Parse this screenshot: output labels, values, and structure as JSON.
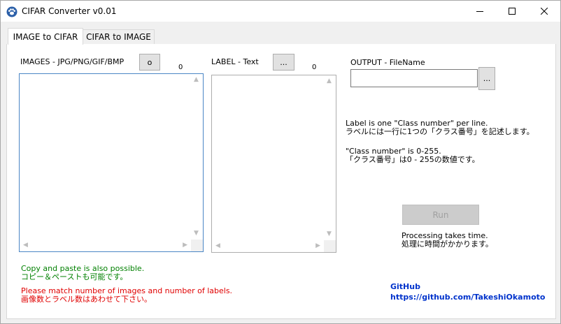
{
  "window": {
    "title": "CIFAR Converter v0.01",
    "minimize_glyph": "—",
    "maximize_glyph": "☐",
    "close_glyph": "✕"
  },
  "tabs": [
    {
      "label": "IMAGE to CIFAR",
      "active": true
    },
    {
      "label": "CIFAR to IMAGE",
      "active": false
    }
  ],
  "images": {
    "label": "IMAGES - JPG/PNG/GIF/BMP",
    "button_label": "o",
    "count": "0"
  },
  "labels": {
    "label": "LABEL - Text",
    "button_label": "...",
    "count": "0"
  },
  "output": {
    "label": "OUTPUT - FileName",
    "value": "",
    "button_label": "..."
  },
  "info": {
    "line1": "Label is one \"Class number\" per line.",
    "line2": "ラベルには一行に1つの「クラス番号」を記述します。",
    "line3": "\"Class number\" is 0-255.",
    "line4": "「クラス番号」は0 - 255の数値です。"
  },
  "run": {
    "label": "Run",
    "note1": "Processing takes time.",
    "note2": "処理に時間がかかります。"
  },
  "hints": {
    "copy1": "Copy and paste is also possible.",
    "copy2": "コピー＆ペーストも可能です。",
    "match1": "Please match number of images and number of labels.",
    "match2": "画像数とラベル数はあわせて下さい。"
  },
  "github": {
    "title": "GitHub",
    "url": "https://github.com/TakeshiOkamoto"
  },
  "colors": {
    "green_text": "#008000",
    "red_text": "#e00000",
    "link_blue": "#0033cc",
    "focus_border": "#4a86c5"
  }
}
